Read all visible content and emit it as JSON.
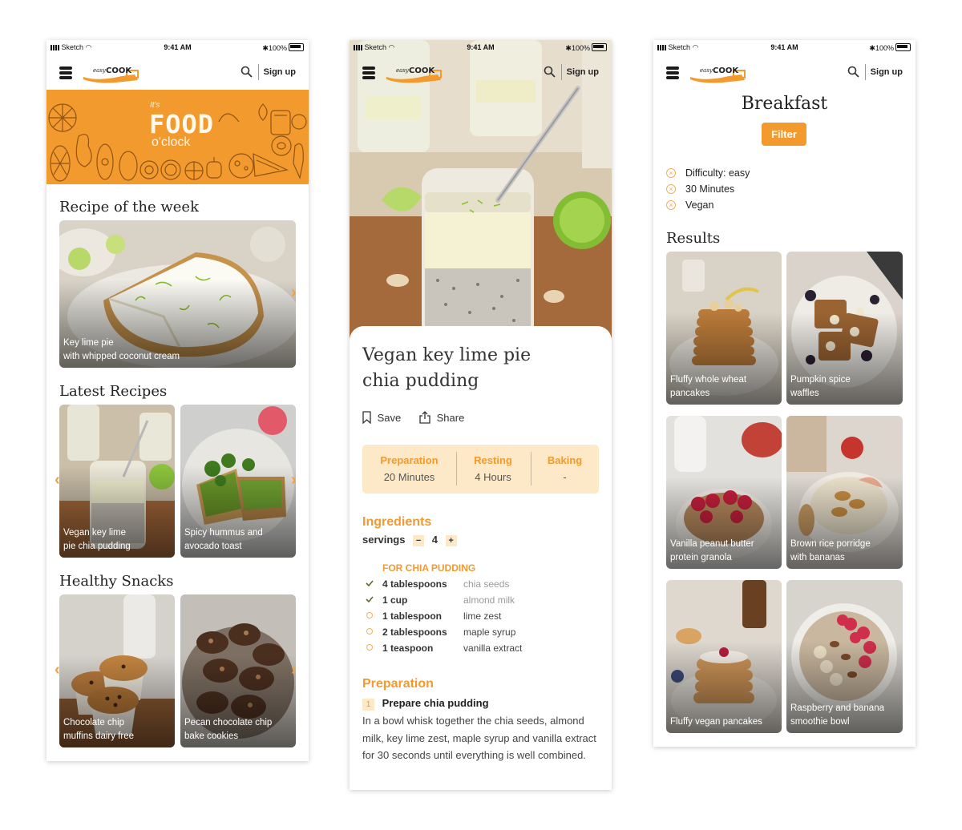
{
  "common": {
    "status_carrier": "Sketch",
    "status_time": "9:41 AM",
    "status_battery": "100%",
    "signup": "Sign up",
    "logo_text": "easy COOK"
  },
  "home": {
    "banner_small": "It's",
    "banner_big": "FOOD",
    "banner_sub": "o'clock",
    "recipe_of_week_title": "Recipe of the week",
    "recipe_of_week_caption_1": "Key lime pie",
    "recipe_of_week_caption_2": "with whipped coconut cream",
    "latest_title": "Latest Recipes",
    "latest": [
      {
        "line1": "Vegan key lime",
        "line2": "pie chia pudding"
      },
      {
        "line1": "Spicy hummus and",
        "line2": "avocado toast"
      }
    ],
    "snacks_title": "Healthy Snacks",
    "snacks": [
      {
        "line1": "Chocolate chip",
        "line2": "muffins dairy free"
      },
      {
        "line1": "Pecan chocolate chip",
        "line2": "bake cookies"
      }
    ]
  },
  "detail": {
    "title_line1": "Vegan key lime pie",
    "title_line2": "chia pudding",
    "save": "Save",
    "share": "Share",
    "times": [
      {
        "label": "Preparation",
        "value": "20 Minutes"
      },
      {
        "label": "Resting",
        "value": "4 Hours"
      },
      {
        "label": "Baking",
        "value": "-"
      }
    ],
    "ingredients_title": "Ingredients",
    "servings_label": "servings",
    "servings_minus": "−",
    "servings_value": "4",
    "servings_plus": "+",
    "group_title": "FOR CHIA PUDDING",
    "ingredients": [
      {
        "qty": "4 tablespoons",
        "item": "chia seeds",
        "checked": true
      },
      {
        "qty": "1 cup",
        "item": "almond milk",
        "checked": true
      },
      {
        "qty": "1 tablespoon",
        "item": "lime zest",
        "checked": false
      },
      {
        "qty": "2 tablespoons",
        "item": "maple syrup",
        "checked": false
      },
      {
        "qty": "1 teaspoon",
        "item": "vanilla extract",
        "checked": false
      }
    ],
    "preparation_title": "Preparation",
    "step_number": "1",
    "step_title": "Prepare chia pudding",
    "step_text": "In a bowl whisk together the chia seeds, almond milk, key lime zest, maple syrup and vanilla extract for 30 seconds until everything is well combined."
  },
  "breakfast": {
    "title": "Breakfast",
    "filter_button": "Filter",
    "tags": [
      "Difficulty: easy",
      "30 Minutes",
      "Vegan"
    ],
    "results_title": "Results",
    "results": [
      {
        "line1": "Fluffy whole wheat",
        "line2": "pancakes"
      },
      {
        "line1": "Pumpkin spice",
        "line2": "waffles"
      },
      {
        "line1": "Vanilla peanut butter",
        "line2": "protein granola"
      },
      {
        "line1": "Brown rice porridge",
        "line2": "with bananas"
      },
      {
        "line1": "",
        "line2": "Fluffy vegan pancakes"
      },
      {
        "line1": "Raspberry and banana",
        "line2": "smoothie bowl"
      }
    ]
  },
  "colors": {
    "accent": "#f39a2f",
    "accent_light": "#fde9c7"
  }
}
